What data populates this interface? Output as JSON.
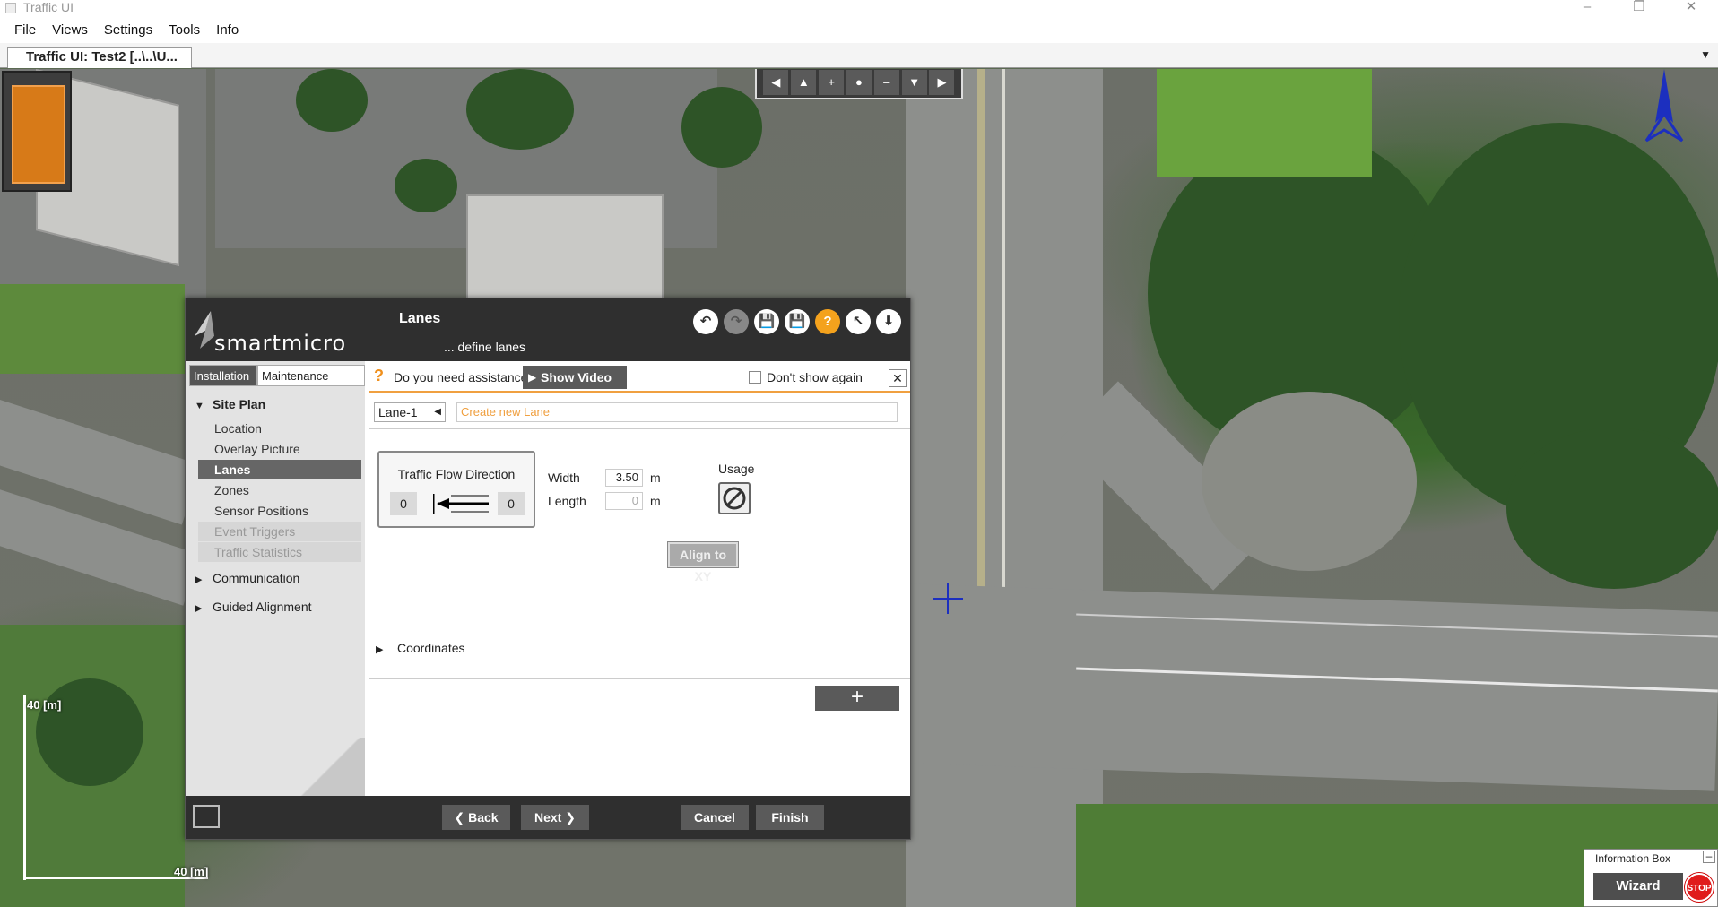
{
  "window": {
    "title": "Traffic UI",
    "minimize": "–",
    "restore": "❐",
    "close": "✕"
  },
  "menu": [
    "File",
    "Views",
    "Settings",
    "Tools",
    "Info"
  ],
  "document_tab": {
    "label": "Traffic UI: Test2 [..\\..\\U..."
  },
  "map": {
    "nav_buttons": [
      "◀",
      "▲",
      "+",
      "●",
      "–",
      "▼",
      "▶"
    ],
    "scale_vertical_label": "40 [m]",
    "scale_horizontal_label": "40 [m]"
  },
  "info_box": {
    "title": "Information Box",
    "minimize": "–",
    "wizard_label": "Wizard",
    "stop_label": "STOP"
  },
  "dialog": {
    "logo": "smartmicro",
    "title": "Lanes",
    "subtitle": "... define lanes",
    "header_icons": [
      "↶",
      "↷",
      "💾",
      "💾",
      "?",
      "↖",
      "⬇"
    ],
    "nav": {
      "tabs": [
        "Installation",
        "Maintenance"
      ],
      "groups": [
        {
          "label": "Site Plan",
          "expanded": true
        },
        {
          "label": "Communication",
          "expanded": false
        },
        {
          "label": "Guided Alignment",
          "expanded": false
        }
      ],
      "site_plan_items": [
        "Location",
        "Overlay Picture",
        "Lanes",
        "Zones",
        "Sensor Positions",
        "Event Triggers",
        "Traffic Statistics"
      ]
    },
    "assist": {
      "question": "Do you need assistance?",
      "show_video": "Show Video",
      "dont_show": "Don't show again",
      "close": "✕"
    },
    "lane_select": "Lane-1",
    "new_lane_placeholder": "Create new Lane",
    "traffic_flow": {
      "label": "Traffic Flow Direction",
      "left_value": "0",
      "right_value": "0"
    },
    "width": {
      "label": "Width",
      "value": "3.50",
      "unit": "m"
    },
    "length": {
      "label": "Length",
      "value": "0",
      "unit": "m"
    },
    "usage_label": "Usage",
    "align_button": "Align to XY",
    "coordinates_label": "Coordinates",
    "add_button": "+",
    "footer": {
      "back": "Back",
      "next": "Next",
      "cancel": "Cancel",
      "finish": "Finish"
    }
  }
}
